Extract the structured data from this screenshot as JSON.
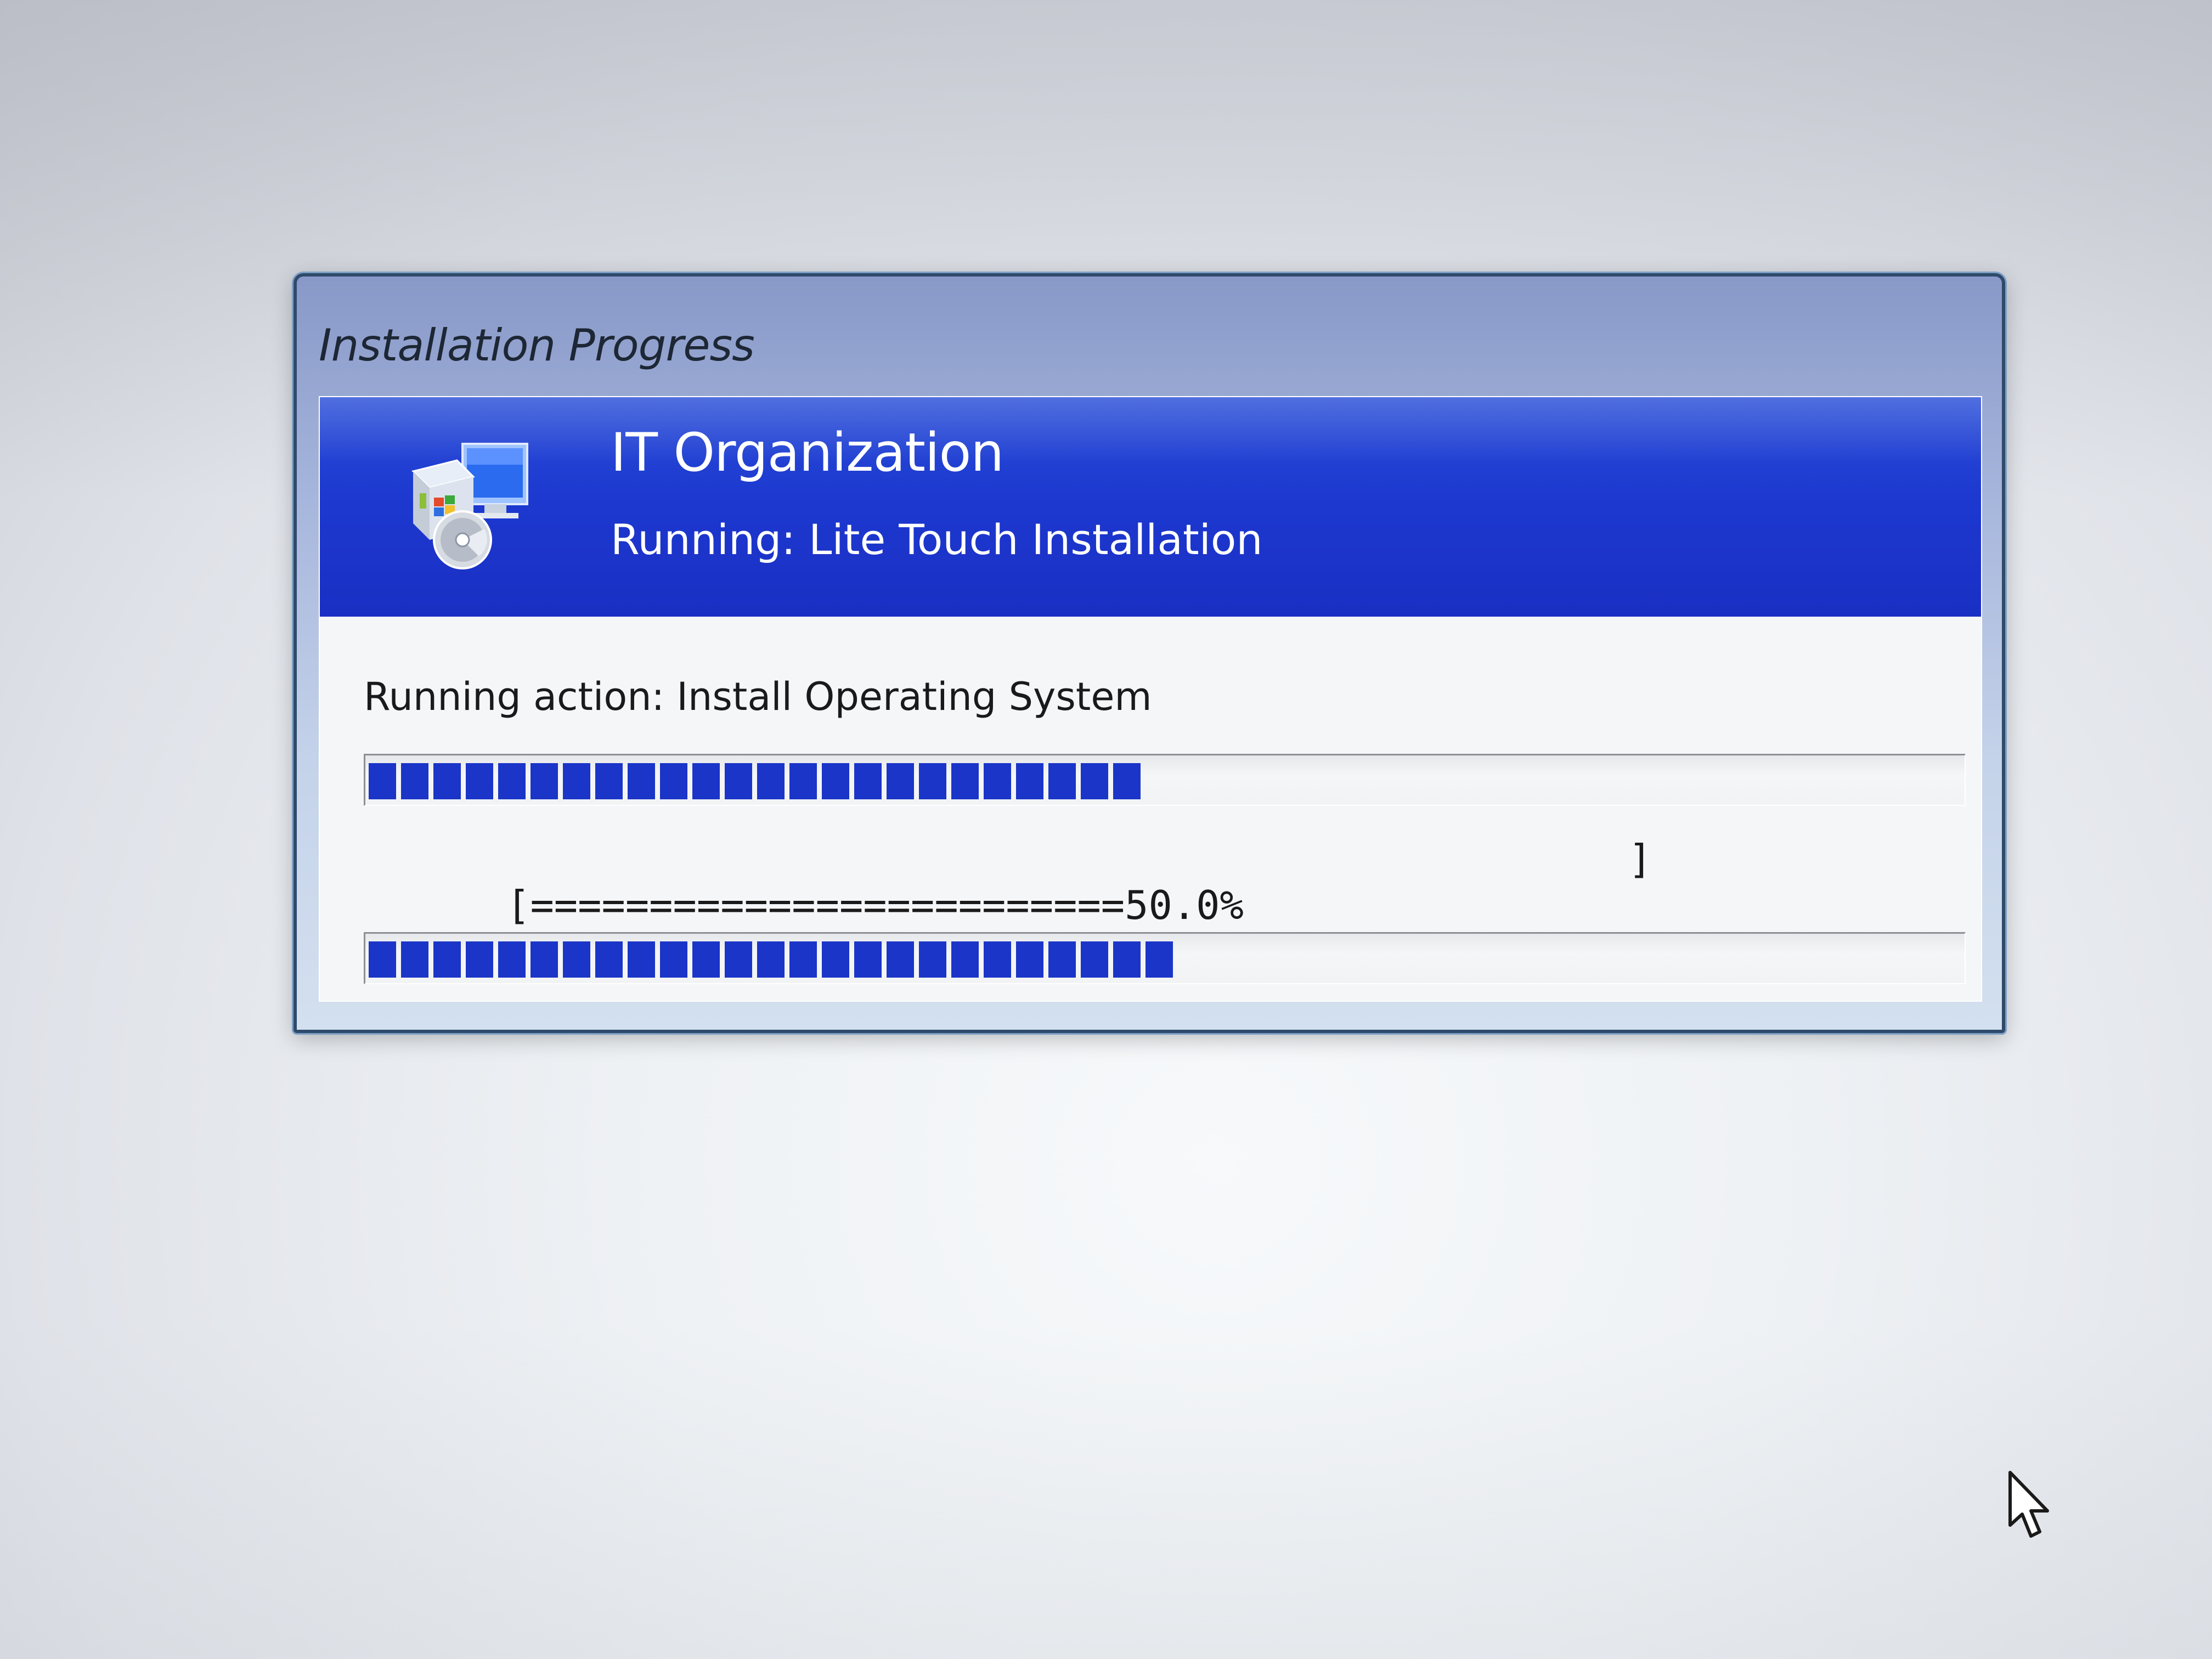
{
  "window": {
    "title": "Installation Progress"
  },
  "banner": {
    "title": "IT Organization",
    "subtitle": "Running: Lite Touch Installation",
    "icon": "installer-monitor-disc-icon"
  },
  "progress": {
    "action_label": "Running action: Install Operating System",
    "action_fraction": 0.49,
    "text_bar": "[=========================50.0%",
    "text_bar_close": "]",
    "overall_fraction": 0.5
  },
  "colors": {
    "banner_blue": "#1d39d0",
    "progress_blue": "#1a35c8"
  },
  "cursor": {
    "icon": "mouse-pointer-icon"
  }
}
